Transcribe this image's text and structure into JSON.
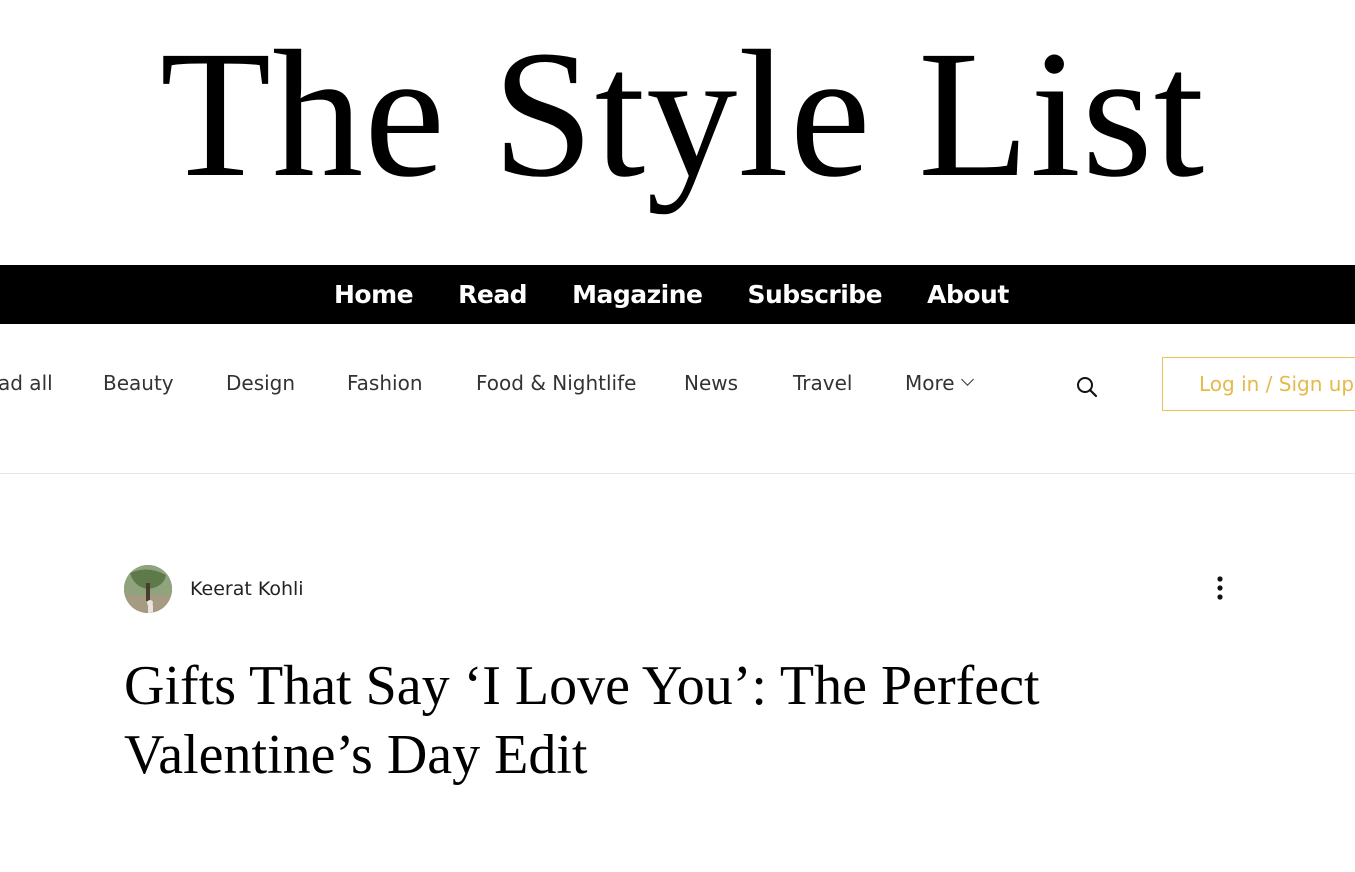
{
  "site": {
    "logo_text": "The Style List"
  },
  "topnav": {
    "items": [
      {
        "label": "Home"
      },
      {
        "label": "Read"
      },
      {
        "label": "Magazine"
      },
      {
        "label": "Subscribe"
      },
      {
        "label": "About"
      }
    ]
  },
  "categories": {
    "items": [
      {
        "label": "ad all"
      },
      {
        "label": "Beauty"
      },
      {
        "label": "Design"
      },
      {
        "label": "Fashion"
      },
      {
        "label": "Food & Nightlife"
      },
      {
        "label": "News"
      },
      {
        "label": "Travel"
      },
      {
        "label": "More"
      }
    ],
    "search_icon": "search-icon",
    "login_label": "Log in / Sign up"
  },
  "post": {
    "author": "Keerat Kohli",
    "title": "Gifts That Say ‘I Love You’: The Perfect Valentine’s Day Edit"
  },
  "colors": {
    "nav_background": "#000000",
    "nav_text": "#ffffff",
    "login_accent": "#e6b94a"
  }
}
